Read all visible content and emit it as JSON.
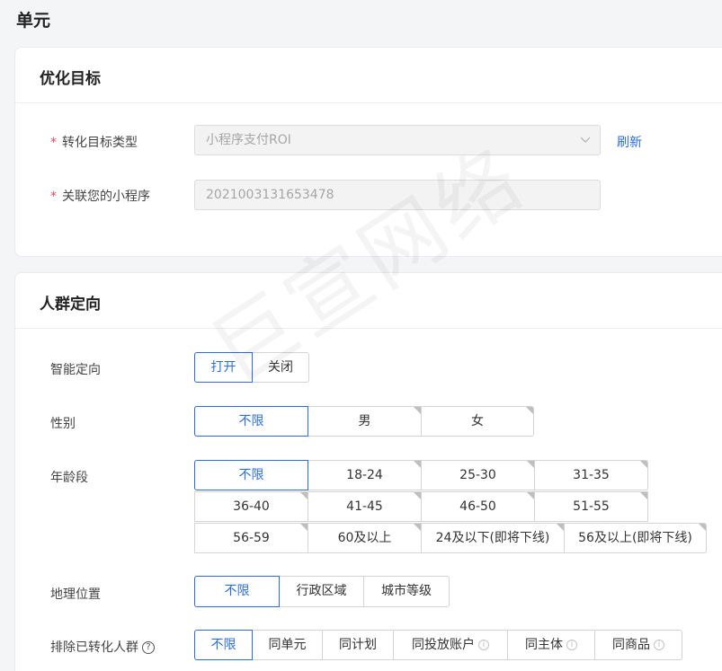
{
  "page": {
    "title": "单元"
  },
  "optimization": {
    "title": "优化目标",
    "conversion_type": {
      "required_mark": "*",
      "label": "转化目标类型",
      "value": "小程序支付ROI",
      "refresh_label": "刷新"
    },
    "mini_program": {
      "required_mark": "*",
      "label": "关联您的小程序",
      "value": "2021003131653478"
    }
  },
  "targeting": {
    "title": "人群定向",
    "smart": {
      "label": "智能定向",
      "options": [
        "打开",
        "关闭"
      ],
      "selected": 0
    },
    "gender": {
      "label": "性别",
      "options": [
        "不限",
        "男",
        "女"
      ],
      "selected": 0
    },
    "age": {
      "label": "年龄段",
      "options": [
        "不限",
        "18-24",
        "25-30",
        "31-35",
        "36-40",
        "41-45",
        "46-50",
        "51-55",
        "56-59",
        "60及以上",
        "24及以下(即将下线)",
        "56及以上(即将下线)"
      ],
      "selected": 0
    },
    "location": {
      "label": "地理位置",
      "options": [
        "不限",
        "行政区域",
        "城市等级"
      ],
      "selected": 0
    },
    "exclude": {
      "label": "排除已转化人群",
      "help": "?",
      "options": [
        "不限",
        "同单元",
        "同计划",
        "同投放账户",
        "同主体",
        "同商品"
      ],
      "info": "i",
      "selected": 0
    }
  },
  "watermark": "巨宣网络"
}
